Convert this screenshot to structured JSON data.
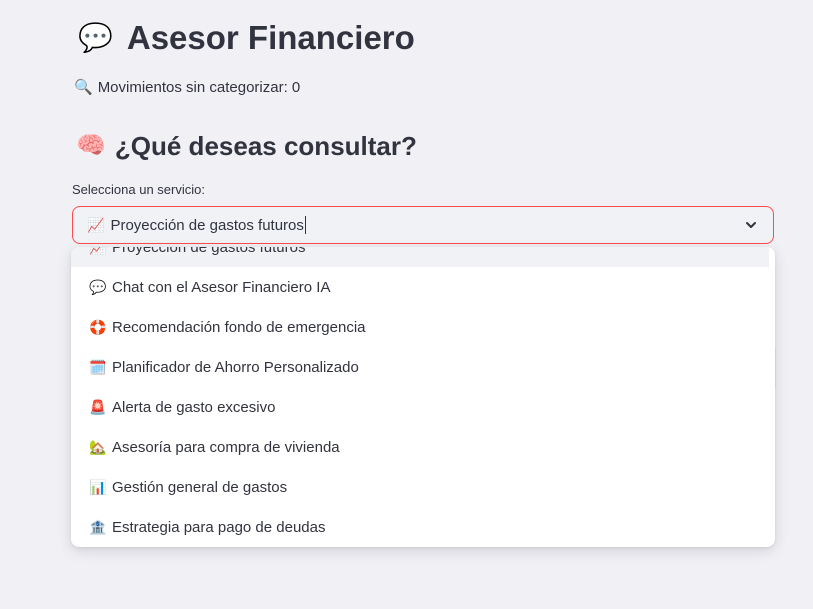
{
  "header": {
    "title_emoji": "💬",
    "title": "Asesor Financiero"
  },
  "status": {
    "emoji": "🔍",
    "uncategorized_text": "Movimientos sin categorizar: 0"
  },
  "section": {
    "emoji": "🧠",
    "heading": "¿Qué deseas consultar?"
  },
  "service_select": {
    "label": "Selecciona un servicio:",
    "selected_emoji": "📈",
    "selected_value": "Proyección de gastos futuros",
    "chevron_icon": "chevron-down-icon",
    "accent_color": "#ff4b4b",
    "options": [
      {
        "emoji": "📈",
        "label": "Proyección de gastos futuros"
      },
      {
        "emoji": "💬",
        "label": "Chat con el Asesor Financiero IA"
      },
      {
        "emoji": "🛟",
        "label": "Recomendación fondo de emergencia"
      },
      {
        "emoji": "🗓️",
        "label": "Planificador de Ahorro Personalizado"
      },
      {
        "emoji": "🚨",
        "label": "Alerta de gasto excesivo"
      },
      {
        "emoji": "🏡",
        "label": "Asesoría para compra de vivienda"
      },
      {
        "emoji": "📊",
        "label": "Gestión general de gastos"
      },
      {
        "emoji": "🏦",
        "label": "Estrategia para pago de deudas"
      }
    ]
  }
}
